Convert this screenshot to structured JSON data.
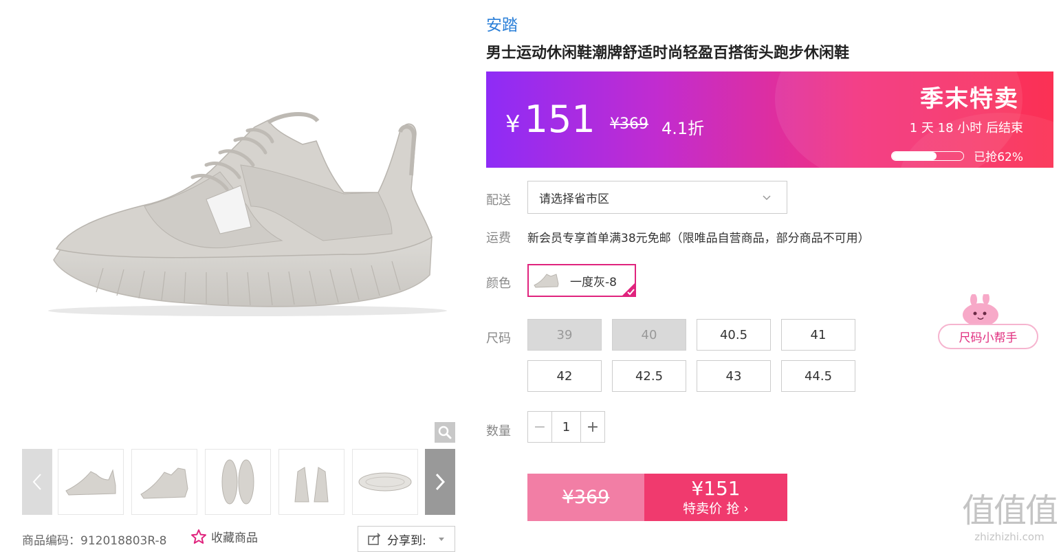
{
  "product": {
    "brand": "安踏",
    "title": "男士运动休闲鞋潮牌舒适时尚轻盈百搭街头跑步休闲鞋",
    "item_code": "商品编码：912018803R-8",
    "favorite_label": "收藏商品",
    "share_label": "分享到:"
  },
  "price_banner": {
    "currency": "¥",
    "current_price": "151",
    "original_price": "¥369",
    "discount": "4.1折",
    "sale_title": "季末特卖",
    "countdown": "1 天 18 小时 后结束",
    "sold_text": "已抢62%",
    "sold_fraction": 0.62
  },
  "delivery": {
    "label": "配送",
    "placeholder": "请选择省市区"
  },
  "shipping": {
    "label": "运费",
    "text": "新会员专享首单满38元免邮（限唯品自营商品，部分商品不可用）"
  },
  "color": {
    "label": "颜色",
    "selected": "一度灰-8"
  },
  "size": {
    "label": "尺码",
    "options": [
      {
        "value": "39",
        "available": false
      },
      {
        "value": "40",
        "available": false
      },
      {
        "value": "40.5",
        "available": true
      },
      {
        "value": "41",
        "available": true
      },
      {
        "value": "42",
        "available": true
      },
      {
        "value": "42.5",
        "available": true
      },
      {
        "value": "43",
        "available": true
      },
      {
        "value": "44.5",
        "available": true
      }
    ],
    "helper_label": "尺码小帮手"
  },
  "quantity": {
    "label": "数量",
    "value": "1",
    "minus": "−",
    "plus": "+"
  },
  "buy_button": {
    "original_price": "¥369",
    "sale_price": "¥151",
    "action_text": "特卖价 抢 ›"
  },
  "watermark": {
    "logo": "值值值",
    "site": "zhizhizhi.com"
  },
  "colors": {
    "accent_pink": "#e0237d",
    "brand_blue": "#2a7fd8",
    "buy_red": "#f03a6e",
    "buy_pink": "#f27ea5"
  },
  "icons": [
    "zoom-icon",
    "arrow-left-icon",
    "arrow-right-icon",
    "star-icon",
    "share-icon",
    "chevron-down-icon",
    "check-icon"
  ]
}
